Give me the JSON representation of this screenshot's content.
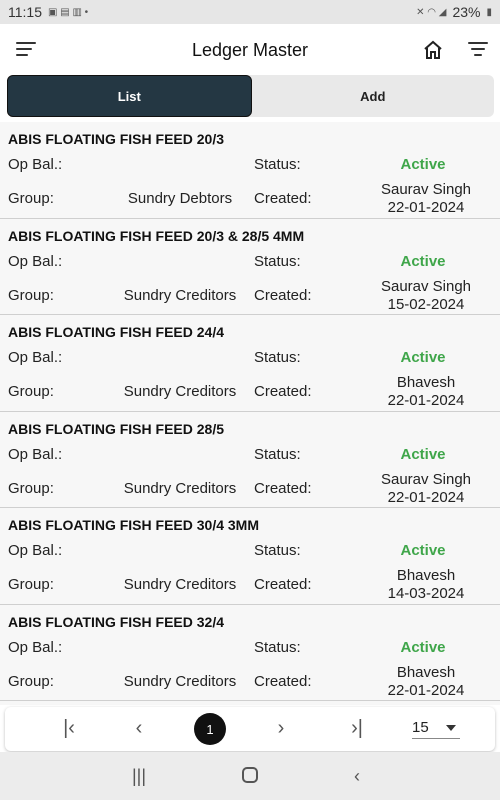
{
  "status_bar": {
    "time": "11:15",
    "battery": "23%"
  },
  "header": {
    "title": "Ledger Master"
  },
  "tabs": [
    {
      "label": "List"
    },
    {
      "label": "Add"
    }
  ],
  "labels": {
    "op_bal": "Op Bal.:",
    "status": "Status:",
    "group": "Group:",
    "created": "Created:"
  },
  "ledgers": [
    {
      "name": "ABIS FLOATING FISH FEED 20/3",
      "op_bal": "",
      "status": "Active",
      "group": "Sundry Debtors",
      "created_by": "Saurav Singh",
      "created_on": "22-01-2024"
    },
    {
      "name": "ABIS FLOATING FISH FEED 20/3 & 28/5 4MM",
      "op_bal": "",
      "status": "Active",
      "group": "Sundry Creditors",
      "created_by": "Saurav Singh",
      "created_on": "15-02-2024"
    },
    {
      "name": "ABIS FLOATING FISH FEED 24/4",
      "op_bal": "",
      "status": "Active",
      "group": "Sundry Creditors",
      "created_by": "Bhavesh",
      "created_on": "22-01-2024"
    },
    {
      "name": "ABIS FLOATING FISH FEED 28/5",
      "op_bal": "",
      "status": "Active",
      "group": "Sundry Creditors",
      "created_by": "Saurav Singh",
      "created_on": "22-01-2024"
    },
    {
      "name": "ABIS FLOATING FISH FEED 30/4 3MM",
      "op_bal": "",
      "status": "Active",
      "group": "Sundry Creditors",
      "created_by": "Bhavesh",
      "created_on": "14-03-2024"
    },
    {
      "name": "ABIS FLOATING FISH FEED 32/4",
      "op_bal": "",
      "status": "Active",
      "group": "Sundry Creditors",
      "created_by": "Bhavesh",
      "created_on": "22-01-2024"
    }
  ],
  "pagination": {
    "current_page": "1",
    "page_size": "15",
    "icons": {
      "first": "first-page-icon",
      "prev": "prev-page-icon",
      "next": "next-page-icon",
      "last": "last-page-icon"
    }
  },
  "colors": {
    "active_tab": "#243743",
    "status_active": "#3fa64a"
  }
}
